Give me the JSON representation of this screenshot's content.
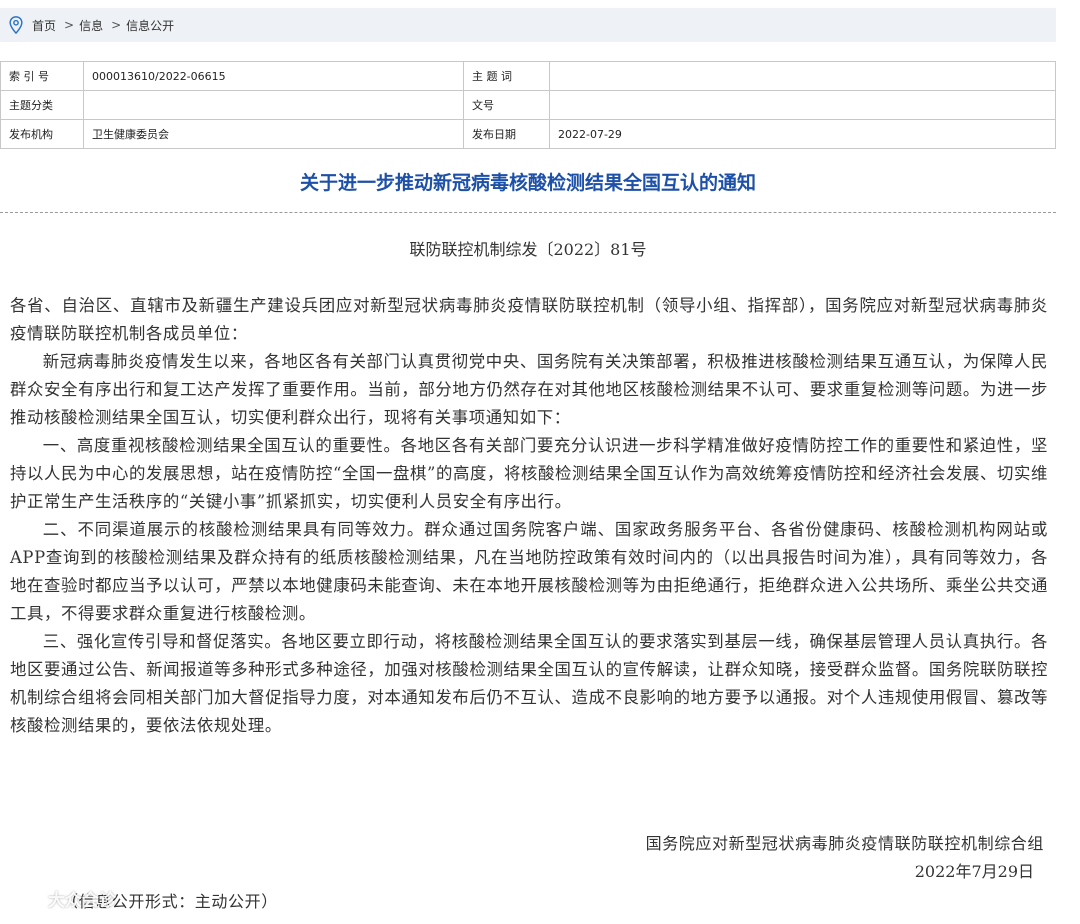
{
  "breadcrumb": {
    "items": [
      "首页",
      "信息",
      "信息公开"
    ],
    "separator": ">",
    "icon": "location-pin-icon"
  },
  "meta": {
    "rows": [
      {
        "k1": "索 引 号",
        "v1": "000013610/2022-06615",
        "k2": "主 题 词",
        "v2": ""
      },
      {
        "k1": "主题分类",
        "v1": "",
        "k2": "文号",
        "v2": ""
      },
      {
        "k1": "发布机构",
        "v1": "卫生健康委员会",
        "k2": "发布日期",
        "v2": "2022-07-29"
      }
    ]
  },
  "title": "关于进一步推动新冠病毒核酸检测结果全国互认的通知",
  "doc_number": "联防联控机制综发〔2022〕81号",
  "paragraphs": [
    {
      "indent": false,
      "text": "各省、自治区、直辖市及新疆生产建设兵团应对新型冠状病毒肺炎疫情联防联控机制（领导小组、指挥部），国务院应对新型冠状病毒肺炎疫情联防联控机制各成员单位："
    },
    {
      "indent": true,
      "text": "新冠病毒肺炎疫情发生以来，各地区各有关部门认真贯彻党中央、国务院有关决策部署，积极推进核酸检测结果互通互认，为保障人民群众安全有序出行和复工达产发挥了重要作用。当前，部分地方仍然存在对其他地区核酸检测结果不认可、要求重复检测等问题。为进一步推动核酸检测结果全国互认，切实便利群众出行，现将有关事项通知如下："
    },
    {
      "indent": true,
      "text": "一、高度重视核酸检测结果全国互认的重要性。各地区各有关部门要充分认识进一步科学精准做好疫情防控工作的重要性和紧迫性，坚持以人民为中心的发展思想，站在疫情防控“全国一盘棋”的高度，将核酸检测结果全国互认作为高效统筹疫情防控和经济社会发展、切实维护正常生产生活秩序的“关键小事”抓紧抓实，切实便利人员安全有序出行。"
    },
    {
      "indent": true,
      "text": "二、不同渠道展示的核酸检测结果具有同等效力。群众通过国务院客户端、国家政务服务平台、各省份健康码、核酸检测机构网站或APP查询到的核酸检测结果及群众持有的纸质核酸检测结果，凡在当地防控政策有效时间内的（以出具报告时间为准），具有同等效力，各地在查验时都应当予以认可，严禁以本地健康码未能查询、未在本地开展核酸检测等为由拒绝通行，拒绝群众进入公共场所、乘坐公共交通工具，不得要求群众重复进行核酸检测。"
    },
    {
      "indent": true,
      "text": "三、强化宣传引导和督促落实。各地区要立即行动，将核酸检测结果全国互认的要求落实到基层一线，确保基层管理人员认真执行。各地区要通过公告、新闻报道等多种形式多种途径，加强对核酸检测结果全国互认的宣传解读，让群众知晓，接受群众监督。国务院联防联控机制综合组将会同相关部门加大督促指导力度，对本通知发布后仍不互认、造成不良影响的地方要予以通报。对个人违规使用假冒、篡改等核酸检测结果的，要依法依规处理。"
    }
  ],
  "signature": {
    "org": "国务院应对新型冠状病毒肺炎疫情联防联控机制综合组",
    "date": "2022年7月29日"
  },
  "disclosure": "（信息公开形式：主动公开）",
  "watermark": "大众会诊"
}
